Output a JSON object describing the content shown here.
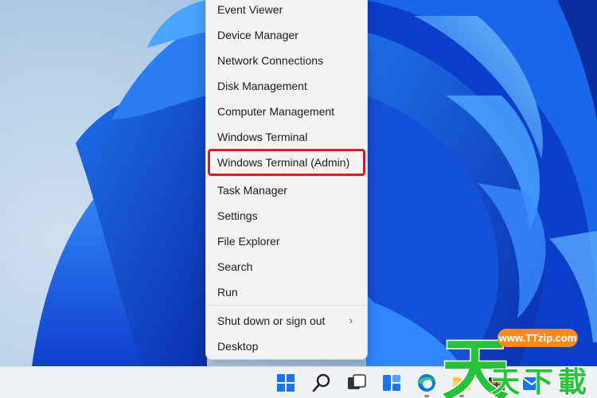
{
  "menu": {
    "items": [
      {
        "label": "Event Viewer"
      },
      {
        "label": "Device Manager"
      },
      {
        "label": "Network Connections"
      },
      {
        "label": "Disk Management"
      },
      {
        "label": "Computer Management"
      },
      {
        "label": "Windows Terminal"
      },
      {
        "label": "Windows Terminal (Admin)",
        "highlighted": true
      },
      {
        "label": "Task Manager"
      },
      {
        "label": "Settings"
      },
      {
        "label": "File Explorer"
      },
      {
        "label": "Search"
      },
      {
        "label": "Run"
      },
      {
        "label": "Shut down or sign out",
        "submenu": true
      },
      {
        "label": "Desktop"
      }
    ],
    "submenu_glyph": "›",
    "highlight_color": "#d61f26"
  },
  "taskbar": {
    "icons": [
      "start-icon",
      "search-icon",
      "task-view-icon",
      "widgets-icon",
      "edge-icon",
      "file-explorer-icon",
      "store-icon",
      "mail-icon"
    ]
  },
  "watermark": {
    "url": "www.TTzip.com",
    "glyph_big": "天",
    "glyphs": "天下載"
  }
}
